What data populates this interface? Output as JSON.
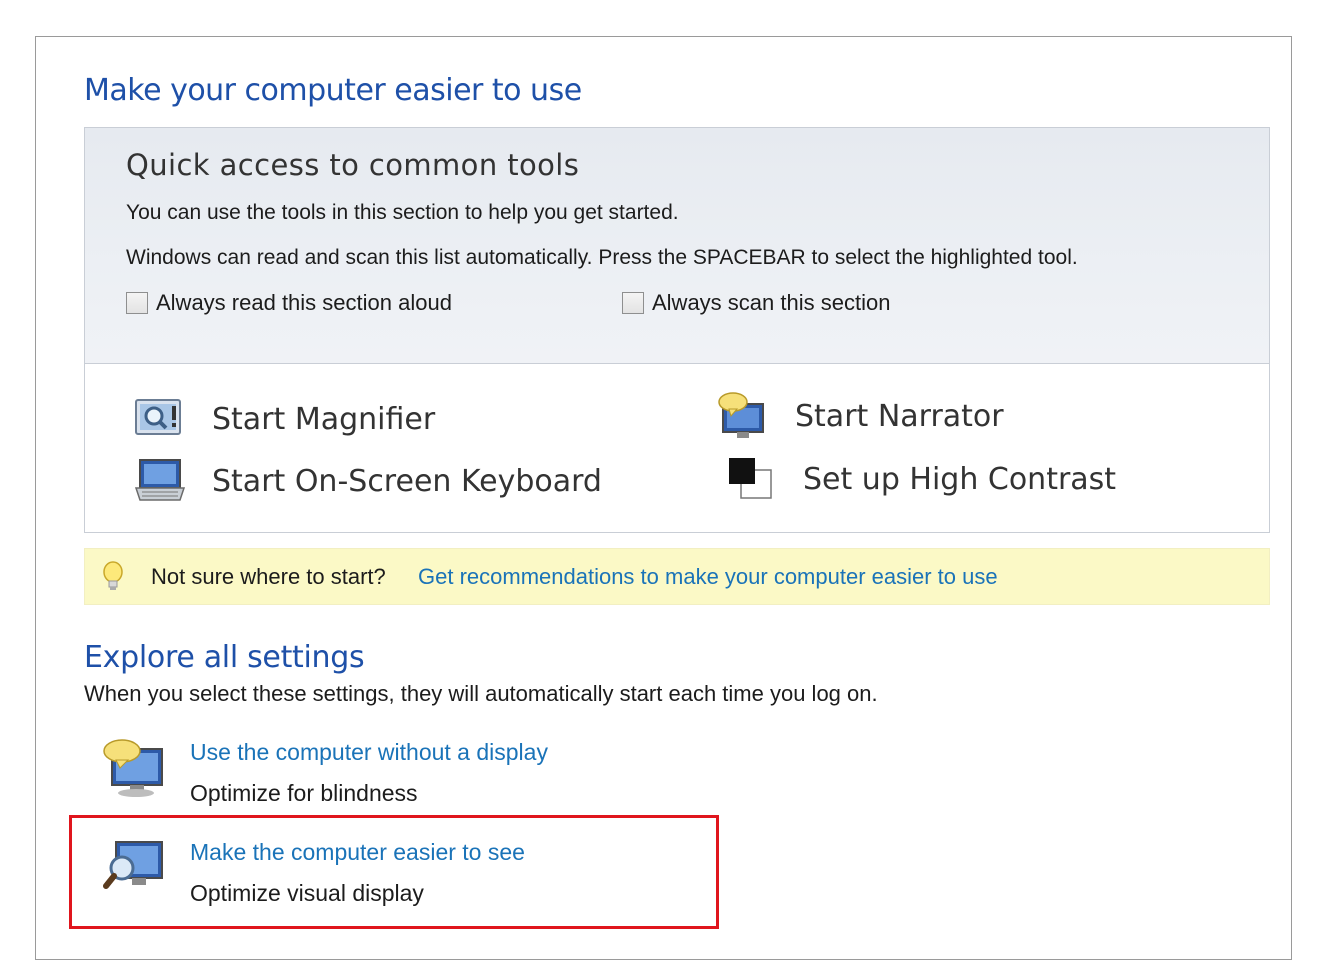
{
  "page": {
    "title": "Make your computer easier to use"
  },
  "quick_access": {
    "title": "Quick access to common tools",
    "line1": "You can use the tools in this section to help you get started.",
    "line2": "Windows can read and scan this list automatically.  Press the SPACEBAR to select the highlighted tool.",
    "checkbox_read": {
      "label": "Always read this section aloud",
      "checked": false
    },
    "checkbox_scan": {
      "label": "Always scan this section",
      "checked": false
    },
    "tools": [
      {
        "label": "Start Magnifier",
        "icon": "magnifier-icon"
      },
      {
        "label": "Start Narrator",
        "icon": "narrator-icon"
      },
      {
        "label": "Start On-Screen Keyboard",
        "icon": "keyboard-icon"
      },
      {
        "label": "Set up High Contrast",
        "icon": "high-contrast-icon"
      }
    ]
  },
  "tip": {
    "text": "Not sure where to start?",
    "link": "Get recommendations to make your computer easier to use",
    "icon": "lightbulb-icon"
  },
  "explore": {
    "title": "Explore all settings",
    "description": "When you select these settings, they will automatically start each time you log on.",
    "settings": [
      {
        "link": "Use the computer without a display",
        "subtitle": "Optimize for blindness",
        "icon": "speech-monitor-icon"
      },
      {
        "link": "Make the computer easier to see",
        "subtitle": "Optimize visual display",
        "icon": "magnify-monitor-icon"
      }
    ]
  },
  "colors": {
    "heading_blue": "#1e50a8",
    "link_blue": "#1a73b8",
    "tip_background": "#fbf9c6",
    "highlight_red": "#e0151d"
  }
}
